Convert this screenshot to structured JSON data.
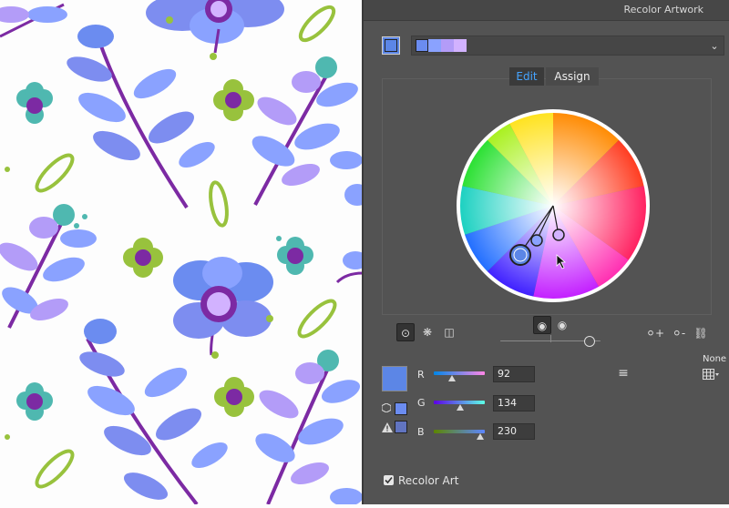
{
  "window": {
    "title": "Recolor Artwork"
  },
  "colors": {
    "primary_swatch": "#5c86e6",
    "color_group": [
      "#6b8cf0",
      "#8aa2ff",
      "#b39cf8",
      "#d2b2ff"
    ],
    "accent": "#46a4ff",
    "panel_bg": "#535353"
  },
  "tabs": [
    {
      "label": "Edit"
    },
    {
      "label": "Assign"
    }
  ],
  "wheel_tools": {
    "left": [
      "smooth-wheel-icon",
      "segmented-wheel-icon",
      "color-bars-icon"
    ],
    "center": [
      "brightness-icon",
      "saturation-icon"
    ],
    "right": [
      "add-color-icon",
      "remove-color-icon",
      "link-harmony-icon"
    ]
  },
  "harmony_slider": {
    "value_fraction": 0.88
  },
  "color_mode": {
    "label": "None"
  },
  "rgb": {
    "r": {
      "label": "R",
      "value": "92"
    },
    "g": {
      "label": "G",
      "value": "134"
    },
    "b": {
      "label": "B",
      "value": "230"
    }
  },
  "recolor_art": {
    "label": "Recolor Art",
    "checked": true
  }
}
